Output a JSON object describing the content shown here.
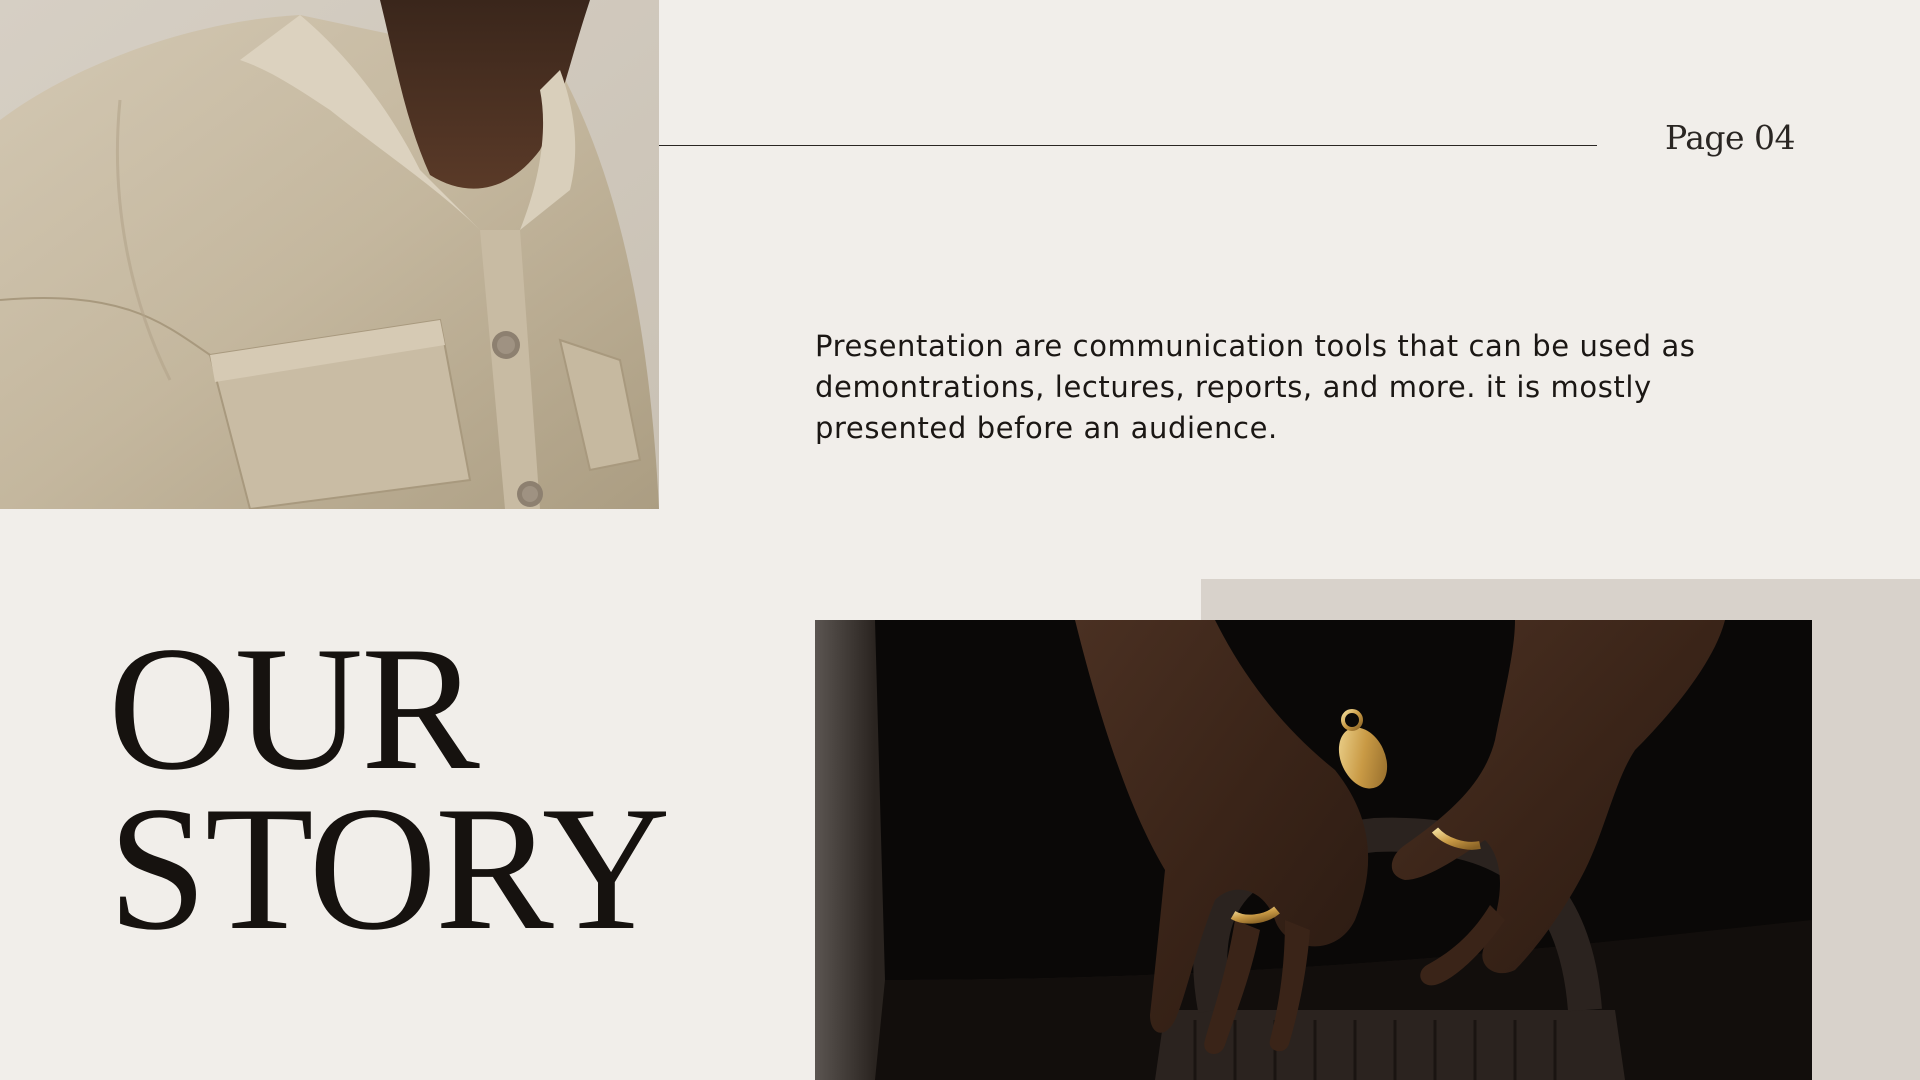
{
  "page": {
    "number_label": "Page 04"
  },
  "body": {
    "paragraph": "Presentation are communication tools that can be used as demontrations, lectures, reports, and more. it is mostly presented before an audience."
  },
  "headline": {
    "line1": "OUR",
    "line2": "STORY"
  },
  "images": {
    "top_left": "shirt-photo",
    "bottom_right": "hands-rings-photo"
  },
  "colors": {
    "background": "#f1eeea",
    "tan_block": "#d8d2cb",
    "text": "#16120f",
    "rule": "#2a2623"
  }
}
